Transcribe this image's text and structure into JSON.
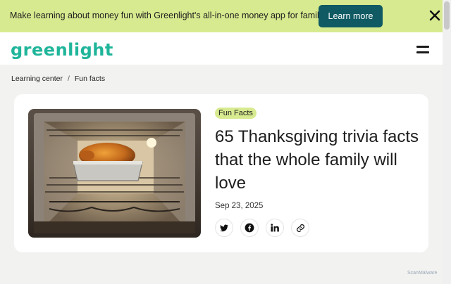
{
  "promo": {
    "text": "Make learning about money fun with Greenlight's all-in-one money app for families.",
    "button_label": "Learn more",
    "accent_color": "#d7ea8f",
    "button_color": "#0f5a63"
  },
  "header": {
    "logo_text": "Greenlight",
    "logo_color": "#1fb59a",
    "menu_icon": "hamburger-icon"
  },
  "breadcrumb": {
    "items": [
      "Learning center",
      "Fun facts"
    ],
    "separator": "/"
  },
  "article": {
    "badge": "Fun Facts",
    "title": "65 Thanksgiving trivia facts that the whole family will love",
    "date": "Sep 23, 2025",
    "image_subject": "roast turkey in oven",
    "share_icons": [
      "twitter-icon",
      "facebook-icon",
      "linkedin-icon",
      "link-icon"
    ]
  },
  "watermark": "ScanMalware"
}
